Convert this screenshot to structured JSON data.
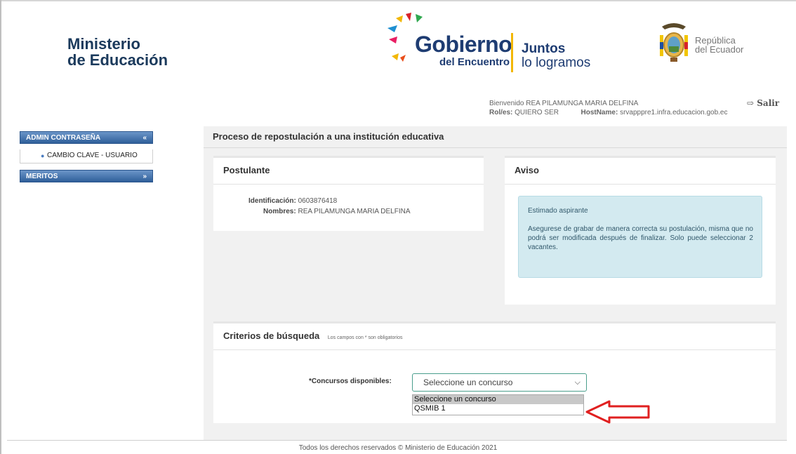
{
  "header": {
    "ministerio_line1": "Ministerio",
    "ministerio_line2": "de Educación",
    "gobierno": "Gobierno",
    "del_encuentro": "del Encuentro",
    "juntos": "Juntos",
    "lo_logramos": "lo logramos",
    "republica": "República",
    "del_ecuador": "del Ecuador",
    "welcome_text": "Bienvenido REA PILAMUNGA MARIA DELFINA",
    "roles_label": "Rol/es:",
    "roles_value": "QUIERO SER",
    "hostname_label": "HostName:",
    "hostname_value": "srvapppre1.infra.educacion.gob.ec",
    "salir_label": "Salir"
  },
  "sidebar": {
    "sections": [
      {
        "label": "ADMIN CONTRASEÑA",
        "chevron": "«",
        "expanded": true,
        "items": [
          "CAMBIO CLAVE - USUARIO"
        ]
      },
      {
        "label": "MERITOS",
        "chevron": "»",
        "expanded": false
      }
    ]
  },
  "main": {
    "title": "Proceso de repostulación a una institución educativa",
    "postulante": {
      "title": "Postulante",
      "id_label": "Identificación:",
      "id_value": "0603876418",
      "nombres_label": "Nombres:",
      "nombres_value": "REA PILAMUNGA MARIA DELFINA"
    },
    "aviso": {
      "title": "Aviso",
      "greeting": "Estimado aspirante",
      "message": "Asegurese de grabar de manera correcta su postulación, misma que no podrá ser modificada después de finalizar. Solo puede seleccionar 2 vacantes."
    },
    "criterios": {
      "title": "Criterios de búsqueda",
      "note": "Los campos con * son obligatorios",
      "concursos_label": "*Concursos disponibles:",
      "select_value": "Seleccione un concurso",
      "options": [
        "Seleccione un concurso",
        "QSMIB 1"
      ]
    }
  },
  "footer": {
    "text": "Todos los derechos reservados © Ministerio de Educación 2021"
  },
  "colors": {
    "accent_blue": "#2f5f9a",
    "alert_bg": "#d3eaf0",
    "arrow_red": "#e02020"
  }
}
